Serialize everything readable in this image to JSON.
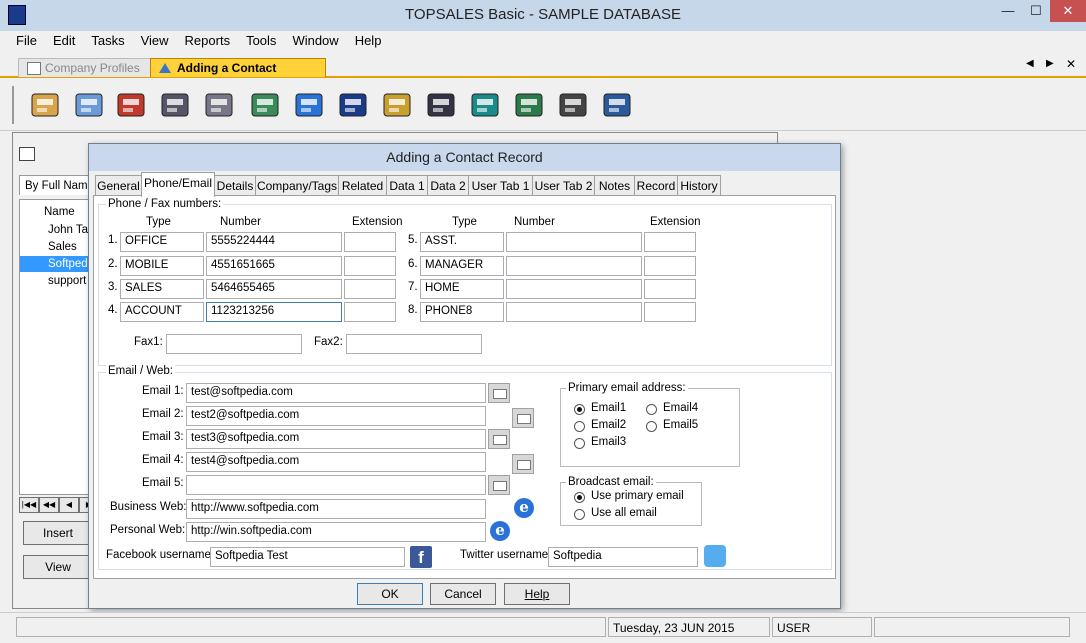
{
  "window": {
    "title": "TOPSALES Basic - SAMPLE DATABASE",
    "minimize": "—",
    "maximize": "☐",
    "close": "✕"
  },
  "menu": [
    "File",
    "Edit",
    "Tasks",
    "View",
    "Reports",
    "Tools",
    "Window",
    "Help"
  ],
  "doc_tabs": {
    "inactive": "Company Profiles",
    "active": "Adding a Contact Record"
  },
  "toolbar_icons": [
    "company-icon",
    "contacts-icon",
    "tasks-icon",
    "letters-icon",
    "calendar-icon",
    "phone-icon",
    "globe-computer-icon",
    "invoice-icon",
    "cash-register-icon",
    "bank-icon",
    "warehouse-icon",
    "document-pen-icon",
    "stopwatch-icon",
    "calculator-icon"
  ],
  "background": {
    "sort_label": "By Full Name",
    "column": "Name",
    "items": [
      "John Tan",
      "Sales",
      "Softpedia",
      "support"
    ],
    "selected_index": 2,
    "insert_button": "Insert",
    "view_button": "View"
  },
  "dialog": {
    "title": "Adding a Contact Record",
    "tabs": [
      "General",
      "Phone/Email",
      "Details",
      "Company/Tags",
      "Related",
      "Data 1",
      "Data 2",
      "User Tab 1",
      "User Tab 2",
      "Notes",
      "Record",
      "History"
    ],
    "active_tab": 1,
    "phone_group": "Phone / Fax numbers:",
    "col_type": "Type",
    "col_number": "Number",
    "col_extension": "Extension",
    "phones": [
      {
        "n": "1.",
        "type": "OFFICE",
        "number": "5555224444",
        "ext": ""
      },
      {
        "n": "2.",
        "type": "MOBILE",
        "number": "4551651665",
        "ext": ""
      },
      {
        "n": "3.",
        "type": "SALES",
        "number": "5464655465",
        "ext": ""
      },
      {
        "n": "4.",
        "type": "ACCOUNT",
        "number": "1123213256",
        "ext": ""
      },
      {
        "n": "5.",
        "type": "ASST.",
        "number": "",
        "ext": ""
      },
      {
        "n": "6.",
        "type": "MANAGER",
        "number": "",
        "ext": ""
      },
      {
        "n": "7.",
        "type": "HOME",
        "number": "",
        "ext": ""
      },
      {
        "n": "8.",
        "type": "PHONE8",
        "number": "",
        "ext": ""
      }
    ],
    "fax1_label": "Fax1:",
    "fax1": "",
    "fax2_label": "Fax2:",
    "fax2": "",
    "email_group": "Email / Web:",
    "emails": [
      {
        "label": "Email 1:",
        "value": "test@softpedia.com"
      },
      {
        "label": "Email 2:",
        "value": "test2@softpedia.com"
      },
      {
        "label": "Email 3:",
        "value": "test3@softpedia.com"
      },
      {
        "label": "Email 4:",
        "value": "test4@softpedia.com"
      },
      {
        "label": "Email 5:",
        "value": ""
      }
    ],
    "business_web_label": "Business Web:",
    "business_web": "http://www.softpedia.com",
    "personal_web_label": "Personal Web:",
    "personal_web": "http://win.softpedia.com",
    "primary_group": "Primary email address:",
    "primary_options": [
      "Email1",
      "Email2",
      "Email3",
      "Email4",
      "Email5"
    ],
    "primary_selected": "Email1",
    "broadcast_group": "Broadcast email:",
    "broadcast_options": [
      "Use primary email",
      "Use all email"
    ],
    "broadcast_selected": "Use primary email",
    "facebook_label": "Facebook username:",
    "facebook": "Softpedia Test",
    "twitter_label": "Twitter username:",
    "twitter": "Softpedia",
    "ok": "OK",
    "cancel": "Cancel",
    "help": "Help"
  },
  "status": {
    "date": "Tuesday, 23 JUN 2015",
    "user": "USER"
  },
  "colors": {
    "accent_tab": "#e8a000",
    "selection": "#3399ff",
    "title_bar": "#c7d7ea"
  }
}
